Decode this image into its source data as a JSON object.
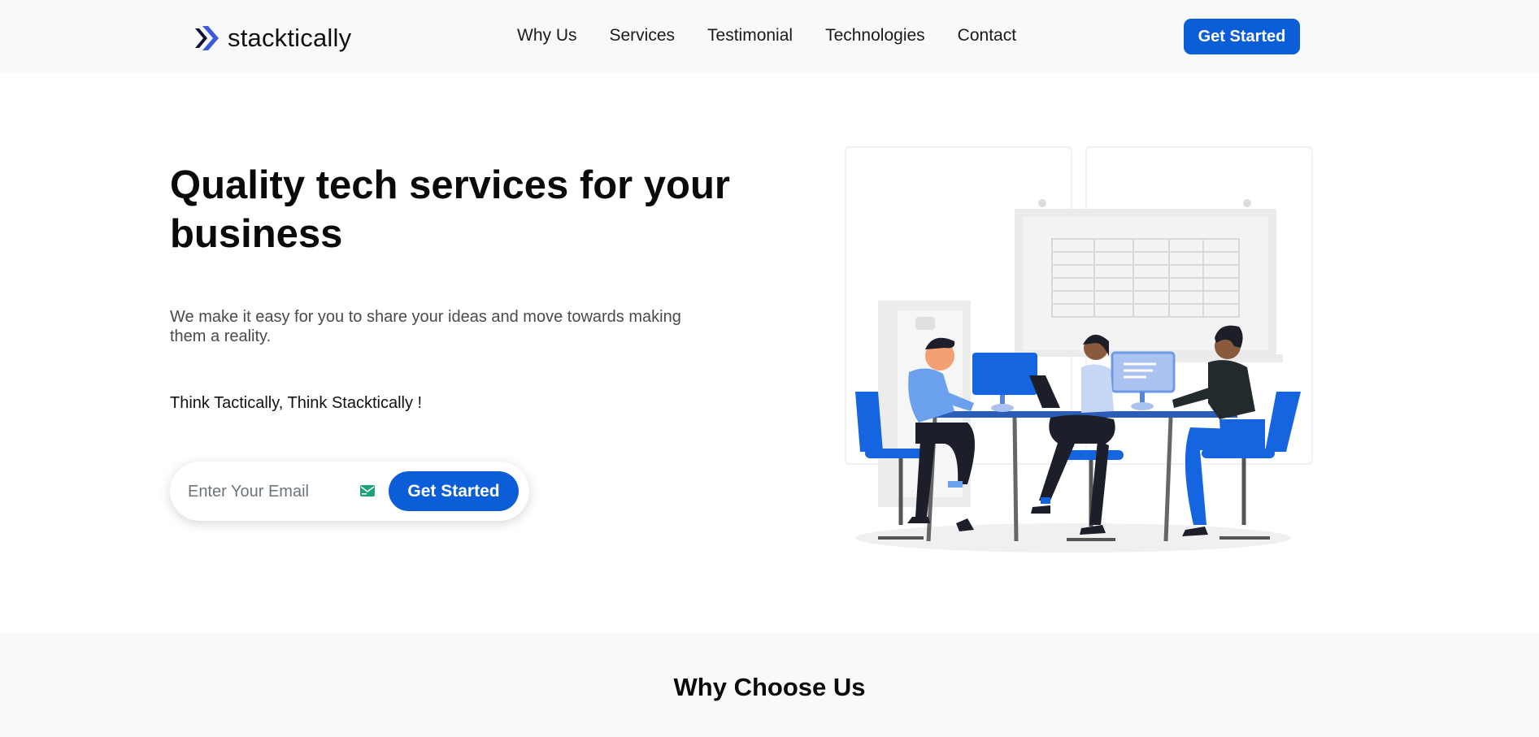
{
  "brand": {
    "name": "stacktically",
    "color": "#0b5ed7"
  },
  "nav": {
    "items": [
      {
        "label": "Why Us"
      },
      {
        "label": "Services"
      },
      {
        "label": "Testimonial"
      },
      {
        "label": "Technologies"
      },
      {
        "label": "Contact"
      }
    ],
    "cta_label": "Get Started"
  },
  "hero": {
    "title": "Quality tech services for your business",
    "subtitle": "We make it easy for you to share your ideas and move towards making them a reality.",
    "tagline": "Think Tactically, Think Stacktically !",
    "email_placeholder": "Enter Your Email",
    "email_icon": "mail-icon",
    "cta_label": "Get Started",
    "illustration": "team-meeting-illustration"
  },
  "why": {
    "title": "Why Choose Us"
  },
  "colors": {
    "accent": "#0b5ed7",
    "header_bg": "#f8f9fa",
    "section_bg": "#f8f9fa"
  }
}
